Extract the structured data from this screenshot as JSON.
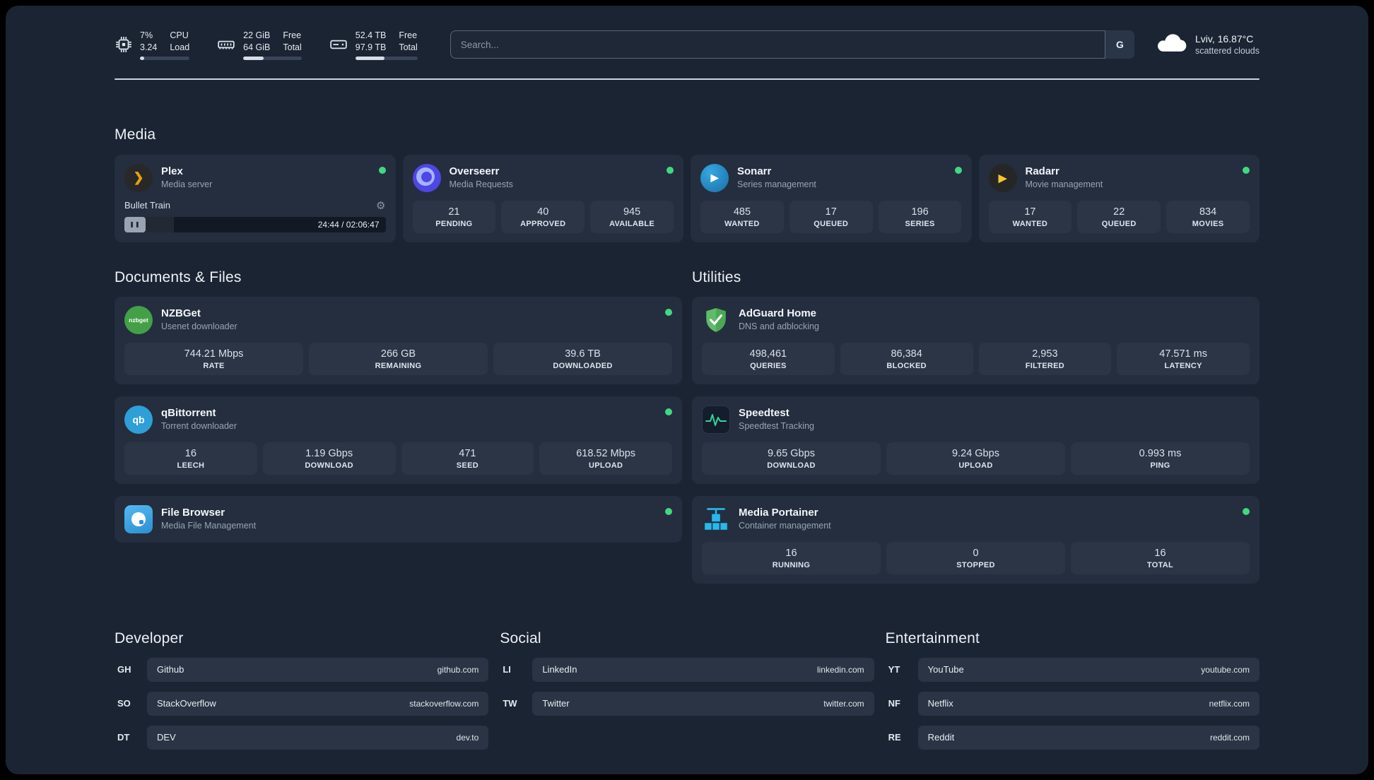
{
  "topbar": {
    "cpu": {
      "percent": "7%",
      "load": "3.24",
      "label_top": "CPU",
      "label_bottom": "Load",
      "bar": "9%"
    },
    "ram": {
      "free": "22 GiB",
      "total": "64 GiB",
      "label_top": "Free",
      "label_bottom": "Total",
      "bar": "35%"
    },
    "disk": {
      "free": "52.4 TB",
      "total": "97.9 TB",
      "label_top": "Free",
      "label_bottom": "Total",
      "bar": "47%"
    },
    "search": {
      "placeholder": "Search...",
      "engine": "G"
    },
    "weather": {
      "location": "Lviv, 16.87°C",
      "condition": "scattered clouds"
    }
  },
  "sections": {
    "media": "Media",
    "documents": "Documents & Files",
    "utilities": "Utilities",
    "developer": "Developer",
    "social": "Social",
    "entertainment": "Entertainment"
  },
  "colors": {
    "status_ok": "#3fd97f",
    "card_bg": "#242e3f",
    "page_bg": "#1b2433"
  },
  "apps": {
    "plex": {
      "name": "Plex",
      "desc": "Media server",
      "now_playing": "Bullet Train",
      "time": "24:44 / 02:06:47",
      "progress": "19%"
    },
    "overseerr": {
      "name": "Overseerr",
      "desc": "Media Requests",
      "stats": [
        {
          "value": "21",
          "label": "PENDING"
        },
        {
          "value": "40",
          "label": "APPROVED"
        },
        {
          "value": "945",
          "label": "AVAILABLE"
        }
      ]
    },
    "sonarr": {
      "name": "Sonarr",
      "desc": "Series management",
      "stats": [
        {
          "value": "485",
          "label": "WANTED"
        },
        {
          "value": "17",
          "label": "QUEUED"
        },
        {
          "value": "196",
          "label": "SERIES"
        }
      ]
    },
    "radarr": {
      "name": "Radarr",
      "desc": "Movie management",
      "stats": [
        {
          "value": "17",
          "label": "WANTED"
        },
        {
          "value": "22",
          "label": "QUEUED"
        },
        {
          "value": "834",
          "label": "MOVIES"
        }
      ]
    },
    "nzbget": {
      "name": "NZBGet",
      "desc": "Usenet downloader",
      "icon_text": "nzbget",
      "stats": [
        {
          "value": "744.21 Mbps",
          "label": "RATE"
        },
        {
          "value": "266 GB",
          "label": "REMAINING"
        },
        {
          "value": "39.6 TB",
          "label": "DOWNLOADED"
        }
      ]
    },
    "qbittorrent": {
      "name": "qBittorrent",
      "desc": "Torrent downloader",
      "icon_text": "qb",
      "stats": [
        {
          "value": "16",
          "label": "LEECH"
        },
        {
          "value": "1.19 Gbps",
          "label": "DOWNLOAD"
        },
        {
          "value": "471",
          "label": "SEED"
        },
        {
          "value": "618.52 Mbps",
          "label": "UPLOAD"
        }
      ]
    },
    "filebrowser": {
      "name": "File Browser",
      "desc": "Media File Management"
    },
    "adguard": {
      "name": "AdGuard Home",
      "desc": "DNS and adblocking",
      "stats": [
        {
          "value": "498,461",
          "label": "QUERIES"
        },
        {
          "value": "86,384",
          "label": "BLOCKED"
        },
        {
          "value": "2,953",
          "label": "FILTERED"
        },
        {
          "value": "47.571 ms",
          "label": "LATENCY"
        }
      ]
    },
    "speedtest": {
      "name": "Speedtest",
      "desc": "Speedtest Tracking",
      "stats": [
        {
          "value": "9.65 Gbps",
          "label": "DOWNLOAD"
        },
        {
          "value": "9.24 Gbps",
          "label": "UPLOAD"
        },
        {
          "value": "0.993 ms",
          "label": "PING"
        }
      ]
    },
    "portainer": {
      "name": "Media Portainer",
      "desc": "Container management",
      "stats": [
        {
          "value": "16",
          "label": "RUNNING"
        },
        {
          "value": "0",
          "label": "STOPPED"
        },
        {
          "value": "16",
          "label": "TOTAL"
        }
      ]
    }
  },
  "bookmarks": {
    "developer": [
      {
        "abbr": "GH",
        "name": "Github",
        "url": "github.com"
      },
      {
        "abbr": "SO",
        "name": "StackOverflow",
        "url": "stackoverflow.com"
      },
      {
        "abbr": "DT",
        "name": "DEV",
        "url": "dev.to"
      }
    ],
    "social": [
      {
        "abbr": "LI",
        "name": "LinkedIn",
        "url": "linkedin.com"
      },
      {
        "abbr": "TW",
        "name": "Twitter",
        "url": "twitter.com"
      }
    ],
    "entertainment": [
      {
        "abbr": "YT",
        "name": "YouTube",
        "url": "youtube.com"
      },
      {
        "abbr": "NF",
        "name": "Netflix",
        "url": "netflix.com"
      },
      {
        "abbr": "RE",
        "name": "Reddit",
        "url": "reddit.com"
      }
    ]
  }
}
